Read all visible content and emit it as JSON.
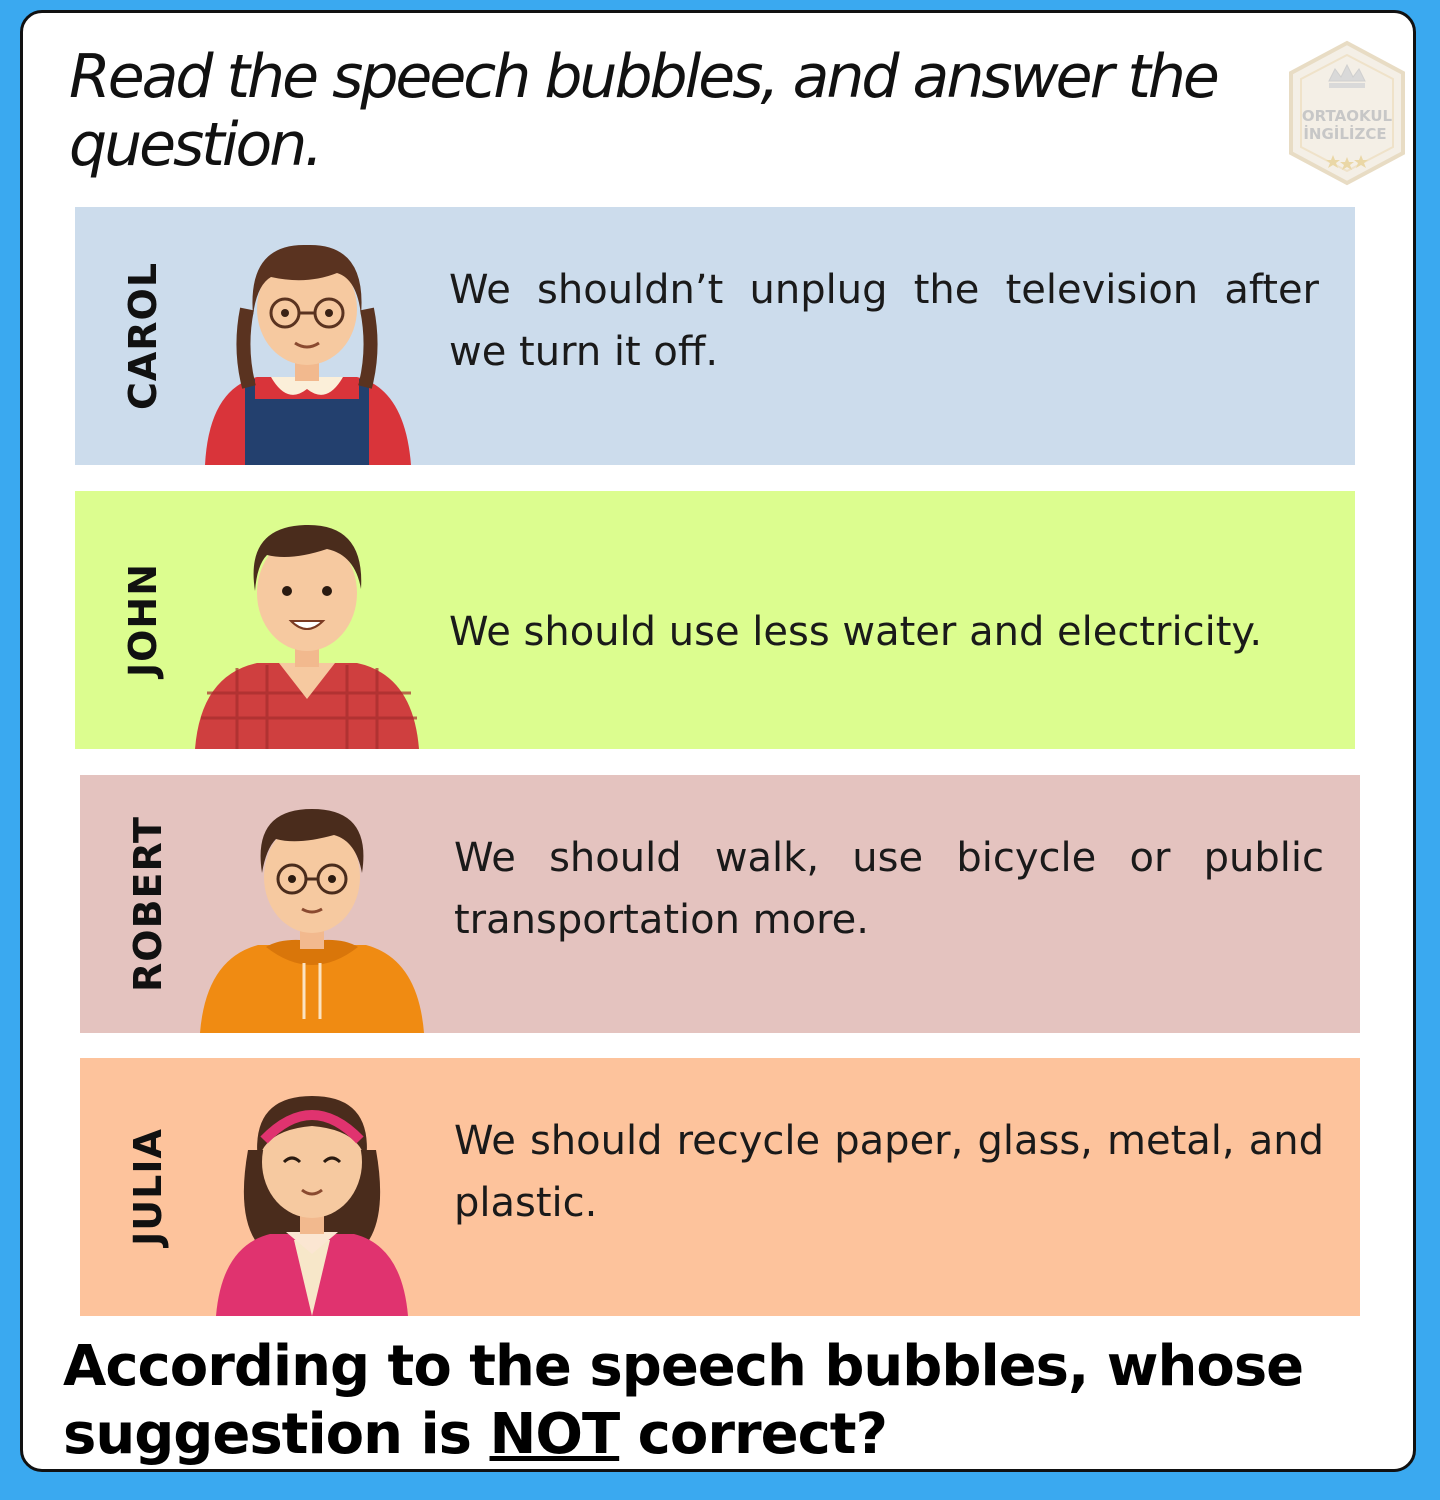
{
  "title": "Read the speech bubbles, and answer the question.",
  "logo": {
    "line1": "ORTAOKUL",
    "line2": "İNGİLİZCE",
    "icon": "crown-icon"
  },
  "rows": [
    {
      "name": "CAROL",
      "text": "We shouldn’t unplug the television after we turn it off.",
      "color": "#ccdcec"
    },
    {
      "name": "JOHN",
      "text": "We should use less water and electricity.",
      "color": "#dcfd8f"
    },
    {
      "name": "ROBERT",
      "text": "We should walk, use bicycle or public transportation more.",
      "color": "#e4c3bf"
    },
    {
      "name": "JULIA",
      "text": "We should recycle paper, glass, metal, and plastic.",
      "color": "#fdc39c"
    }
  ],
  "question": {
    "part1": "According to the speech bubbles, whose suggestion is ",
    "emphasis": "NOT",
    "part2": " correct?"
  },
  "colors": {
    "background": "#3aa9f0",
    "card": "#ffffff"
  }
}
